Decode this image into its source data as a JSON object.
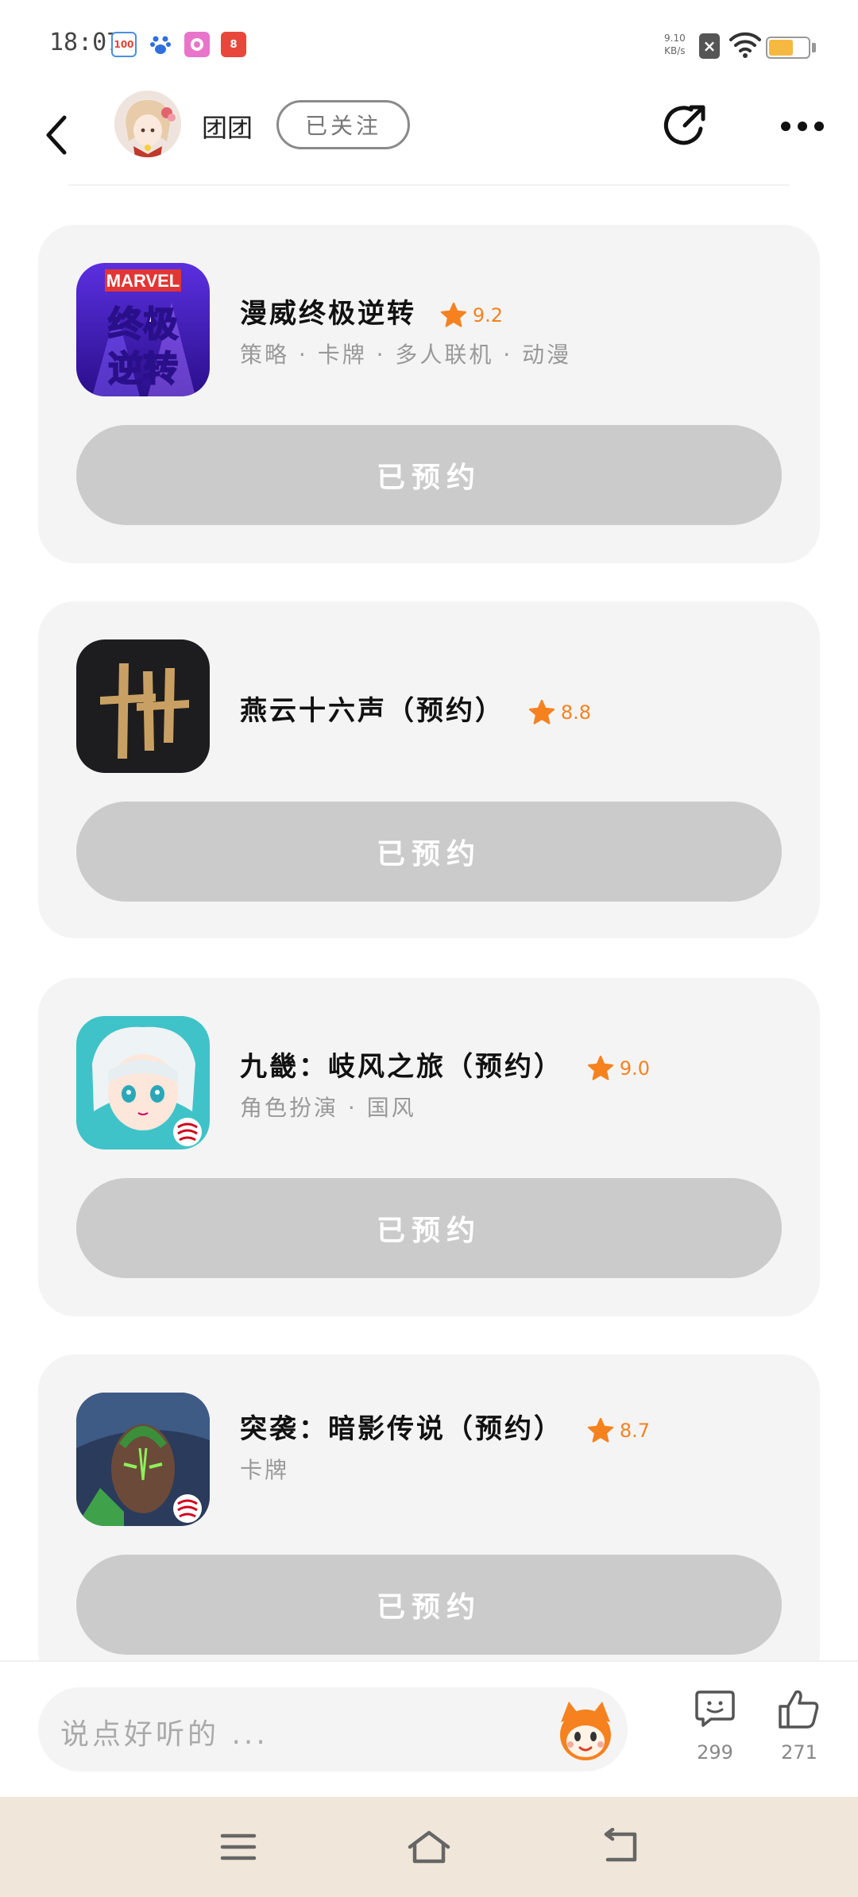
{
  "status_bar": {
    "time": "18:07",
    "notifications": [
      {
        "icon": "app-100-icon",
        "label": "100",
        "color": "#4a90e2"
      },
      {
        "icon": "baidu-paw-icon",
        "label": "",
        "color": "#2f6fe0"
      },
      {
        "icon": "camera-app-icon",
        "label": "",
        "color": "#e875c9"
      },
      {
        "icon": "app-8-icon",
        "label": "8",
        "color": "#e9473b"
      }
    ],
    "net_speed_value": "9.10",
    "net_speed_unit": "KB/s",
    "sim_label": "×",
    "battery_level": 0.62
  },
  "header": {
    "username": "团团",
    "follow_label": "已关注"
  },
  "games": [
    {
      "name": "漫威终极逆转",
      "rating": "9.2",
      "tags": "策略 · 卡牌 · 多人联机 · 动漫",
      "button_label": "已预约",
      "icon": "marvel-snap-icon"
    },
    {
      "name": "燕云十六声（预约）",
      "rating": "8.8",
      "tags": "",
      "button_label": "已预约",
      "icon": "yanyun-icon"
    },
    {
      "name": "九畿：岐风之旅（预约）",
      "rating": "9.0",
      "tags": "角色扮演 · 国风",
      "button_label": "已预约",
      "icon": "jiuji-icon"
    },
    {
      "name": "突袭：暗影传说（预约）",
      "rating": "8.7",
      "tags": "卡牌",
      "button_label": "已预约",
      "icon": "raid-icon"
    }
  ],
  "comment_bar": {
    "placeholder": "说点好听的 ...",
    "comment_count": "299",
    "like_count": "271"
  },
  "colors": {
    "accent_orange": "#f5821f",
    "card_bg": "#f4f4f4",
    "reserved_btn": "#cbcbcb",
    "nav_bg": "#f0e6da"
  }
}
